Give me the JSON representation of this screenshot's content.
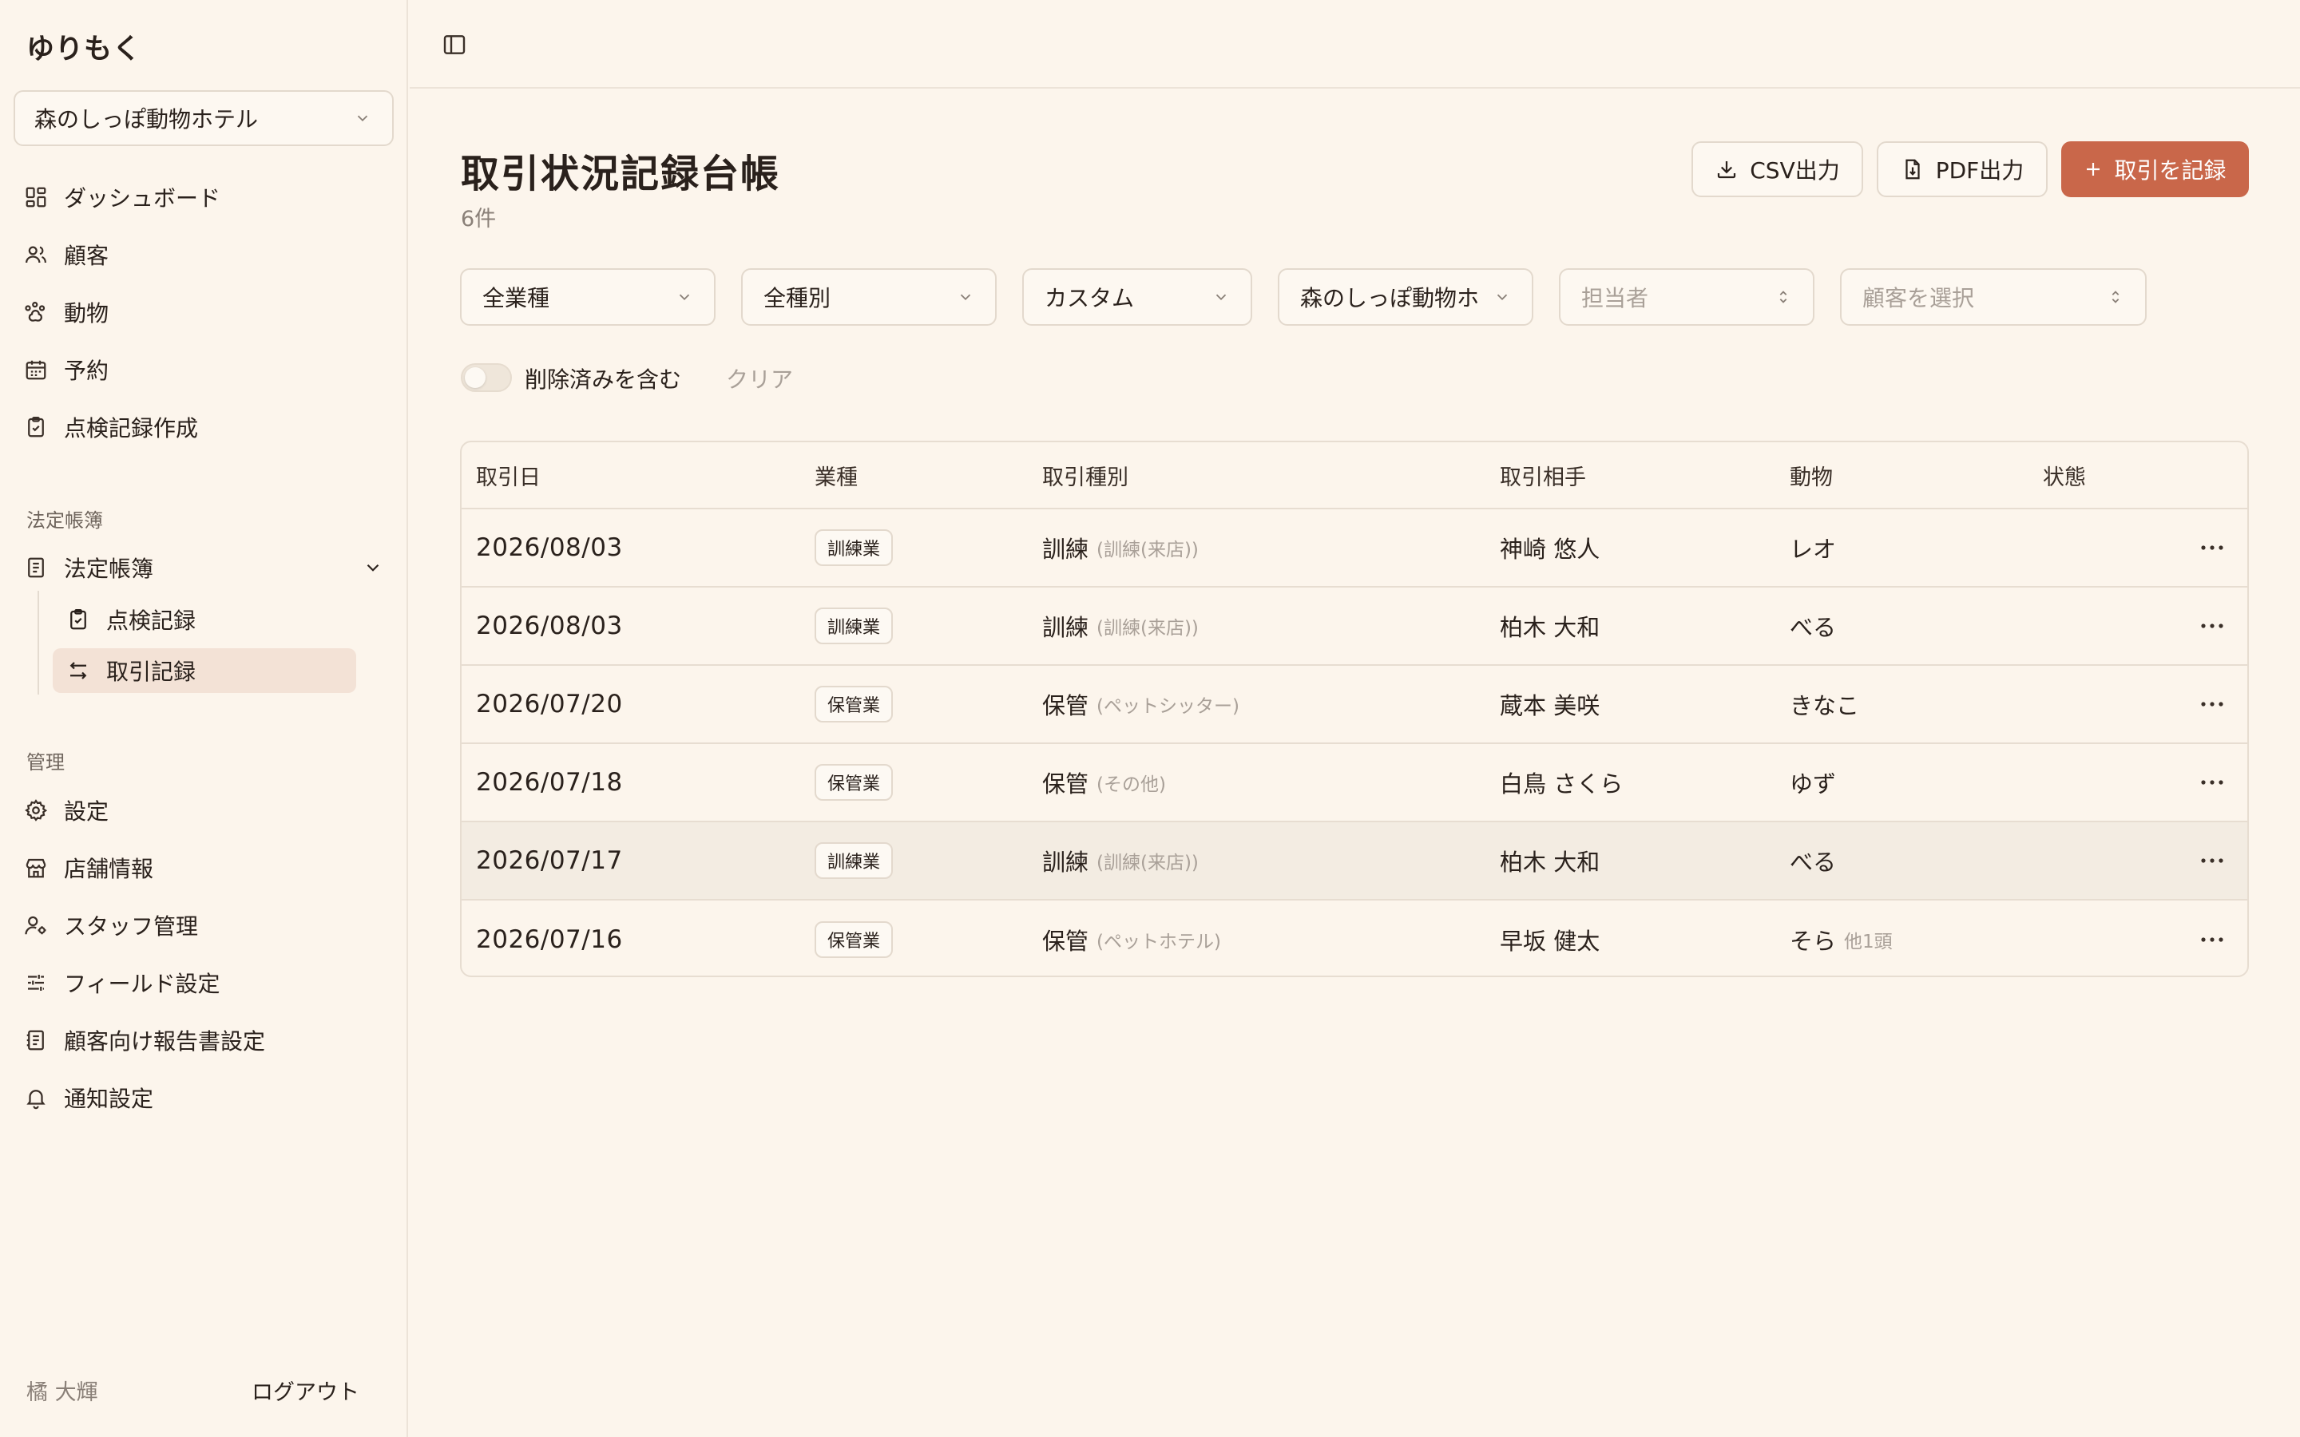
{
  "app": {
    "name": "ゆりもく"
  },
  "sidebar": {
    "store": "森のしっぽ動物ホテル",
    "main_items": [
      {
        "label": "ダッシュボード",
        "icon": "dashboard-icon"
      },
      {
        "label": "顧客",
        "icon": "users-icon"
      },
      {
        "label": "動物",
        "icon": "paw-icon"
      },
      {
        "label": "予約",
        "icon": "calendar-icon"
      },
      {
        "label": "点検記録作成",
        "icon": "clipboard-check-icon"
      }
    ],
    "ledger_section": "法定帳簿",
    "ledger_group": "法定帳簿",
    "ledger_items": [
      {
        "label": "点検記録",
        "icon": "clipboard-check-icon"
      },
      {
        "label": "取引記録",
        "icon": "arrows-exchange-icon",
        "active": true
      }
    ],
    "admin_section": "管理",
    "admin_items": [
      {
        "label": "設定",
        "icon": "gear-icon"
      },
      {
        "label": "店舗情報",
        "icon": "store-icon"
      },
      {
        "label": "スタッフ管理",
        "icon": "user-cog-icon"
      },
      {
        "label": "フィールド設定",
        "icon": "sliders-icon"
      },
      {
        "label": "顧客向け報告書設定",
        "icon": "report-icon"
      },
      {
        "label": "通知設定",
        "icon": "bell-icon"
      }
    ],
    "user": "橘 大輝",
    "logout": "ログアウト"
  },
  "page": {
    "title": "取引状況記録台帳",
    "count": "6件",
    "buttons": {
      "csv": "CSV出力",
      "pdf": "PDF出力",
      "add": "取引を記録"
    }
  },
  "filters": {
    "business_type": "全業種",
    "kind": "全種別",
    "period": "カスタム",
    "store": "森のしっぽ動物ホ",
    "staff_placeholder": "担当者",
    "customer_placeholder": "顧客を選択",
    "include_deleted": "削除済みを含む",
    "include_deleted_on": false,
    "clear": "クリア"
  },
  "table": {
    "columns": [
      "取引日",
      "業種",
      "取引種別",
      "取引相手",
      "動物",
      "状態"
    ],
    "rows": [
      {
        "date": "2026/08/03",
        "business": "訓練業",
        "type": "訓練",
        "type_note": "(訓練(来店))",
        "partner": "神崎 悠人",
        "animal": "レオ",
        "animal_note": "",
        "status": ""
      },
      {
        "date": "2026/08/03",
        "business": "訓練業",
        "type": "訓練",
        "type_note": "(訓練(来店))",
        "partner": "柏木 大和",
        "animal": "べる",
        "animal_note": "",
        "status": ""
      },
      {
        "date": "2026/07/20",
        "business": "保管業",
        "type": "保管",
        "type_note": "(ペットシッター)",
        "partner": "蔵本 美咲",
        "animal": "きなこ",
        "animal_note": "",
        "status": ""
      },
      {
        "date": "2026/07/18",
        "business": "保管業",
        "type": "保管",
        "type_note": "(その他)",
        "partner": "白鳥 さくら",
        "animal": "ゆず",
        "animal_note": "",
        "status": ""
      },
      {
        "date": "2026/07/17",
        "business": "訓練業",
        "type": "訓練",
        "type_note": "(訓練(来店))",
        "partner": "柏木 大和",
        "animal": "べる",
        "animal_note": "",
        "status": ""
      },
      {
        "date": "2026/07/16",
        "business": "保管業",
        "type": "保管",
        "type_note": "(ペットホテル)",
        "partner": "早坂 健太",
        "animal": "そら",
        "animal_note": "他1頭",
        "status": ""
      }
    ]
  },
  "colors": {
    "background": "#fcf5ec",
    "accent": "#c9674a",
    "active_nav": "#f3e2d6",
    "border": "#e7ddd1"
  }
}
